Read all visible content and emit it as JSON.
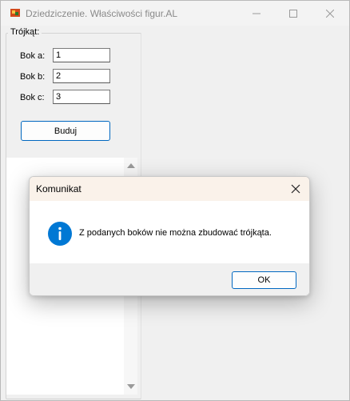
{
  "window": {
    "title": "Dziedziczenie. Właściwości figur.AL",
    "icon": "app-icon",
    "controls": [
      "minimize-icon",
      "maximize-icon",
      "close-icon"
    ]
  },
  "group": {
    "label": "Trójkąt:",
    "fields": [
      {
        "label": "Bok a:",
        "value": "1"
      },
      {
        "label": "Bok b:",
        "value": "2"
      },
      {
        "label": "Bok c:",
        "value": "3"
      }
    ],
    "build_label": "Buduj"
  },
  "dialog": {
    "title": "Komunikat",
    "message": "Z podanych boków nie można zbudować trójkąta.",
    "ok_label": "OK",
    "icon": "info-icon",
    "accent": "#0078d4"
  }
}
